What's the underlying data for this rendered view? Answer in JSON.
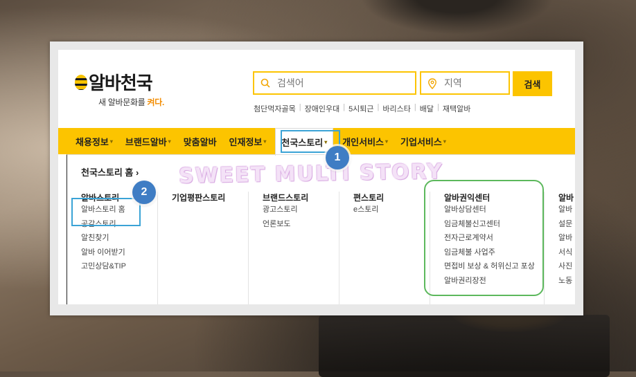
{
  "logo": {
    "name": "알바천국",
    "tagline_prefix": "새 알바문화를 ",
    "tagline_accent": "켜다."
  },
  "search": {
    "keyword_placeholder": "검색어",
    "region_placeholder": "지역",
    "button_label": "검색"
  },
  "quick_links": [
    "첨단먹자골목",
    "장애인우대",
    "5시퇴근",
    "바리스타",
    "배달",
    "재택알바"
  ],
  "gnb": [
    {
      "label": "채용정보",
      "caret": "▾"
    },
    {
      "label": "브랜드알바",
      "caret": "▾"
    },
    {
      "label": "맞춤알바",
      "caret": ""
    },
    {
      "label": "인재정보",
      "caret": "▾"
    },
    {
      "label": "천국스토리",
      "caret": "▾"
    },
    {
      "label": "개인서비스",
      "caret": "▾"
    },
    {
      "label": "기업서비스",
      "caret": "▾"
    }
  ],
  "mega": {
    "home_link": "천국스토리 홈 ›",
    "columns": [
      {
        "title": "알바스토리",
        "links": [
          "알바스토리 홈",
          "공감스토리",
          "알친찾기",
          "알바 이어받기",
          "고민상담&TIP"
        ]
      },
      {
        "title": "기업평판스토리",
        "links": []
      },
      {
        "title": "브랜드스토리",
        "links": [
          "광고스토리",
          "언론보도"
        ]
      },
      {
        "title": "편스토리",
        "links": [
          "e스토리"
        ]
      },
      {
        "title": "알바권익센터",
        "links": [
          "알바상담센터",
          "임금체불신고센터",
          "전자근로계약서",
          "임금체불 사업주",
          "면접비 보상 & 허위신고 포상",
          "알바권리장전"
        ]
      },
      {
        "title": "알바",
        "links": [
          "알바",
          "설문",
          "알바",
          "서식",
          "사진",
          "노동"
        ]
      }
    ]
  },
  "annotations": {
    "badge_1": "1",
    "badge_2": "2"
  },
  "watermark": "SWEET MULTI STORY",
  "colors": {
    "brand_yellow": "#fcc400",
    "highlight_blue": "#3aa3d6",
    "badge_blue": "#3f7dc4",
    "frame_green": "#5cb85c"
  }
}
